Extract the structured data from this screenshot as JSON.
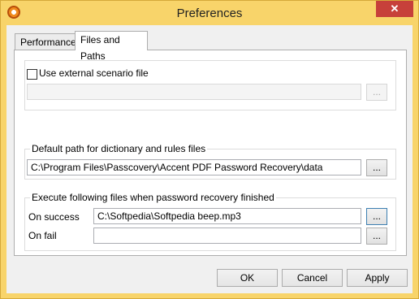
{
  "window": {
    "title": "Preferences",
    "close_glyph": "✕",
    "app_icon": "passcovery-icon"
  },
  "tabs": [
    {
      "label": "Performance",
      "active": false
    },
    {
      "label": "Files and Paths",
      "active": true
    }
  ],
  "external_scenario": {
    "checkbox_label": "Use external scenario file",
    "checked": false,
    "path_value": "",
    "browse_label": "..."
  },
  "default_path": {
    "legend": "Default path for dictionary and rules files",
    "path_value": "C:\\Program Files\\Passcovery\\Accent PDF Password Recovery\\data",
    "browse_label": "..."
  },
  "execute_files": {
    "legend": "Execute following files when password recovery finished",
    "on_success_label": "On success",
    "on_success_value": "C:\\Softpedia\\Softpedia beep.mp3",
    "on_fail_label": "On fail",
    "on_fail_value": "",
    "browse_label": "..."
  },
  "buttons": {
    "ok": "OK",
    "cancel": "Cancel",
    "apply": "Apply"
  },
  "colors": {
    "frame": "#f8d46a",
    "close": "#c7403a",
    "client": "#f0f0f0"
  }
}
